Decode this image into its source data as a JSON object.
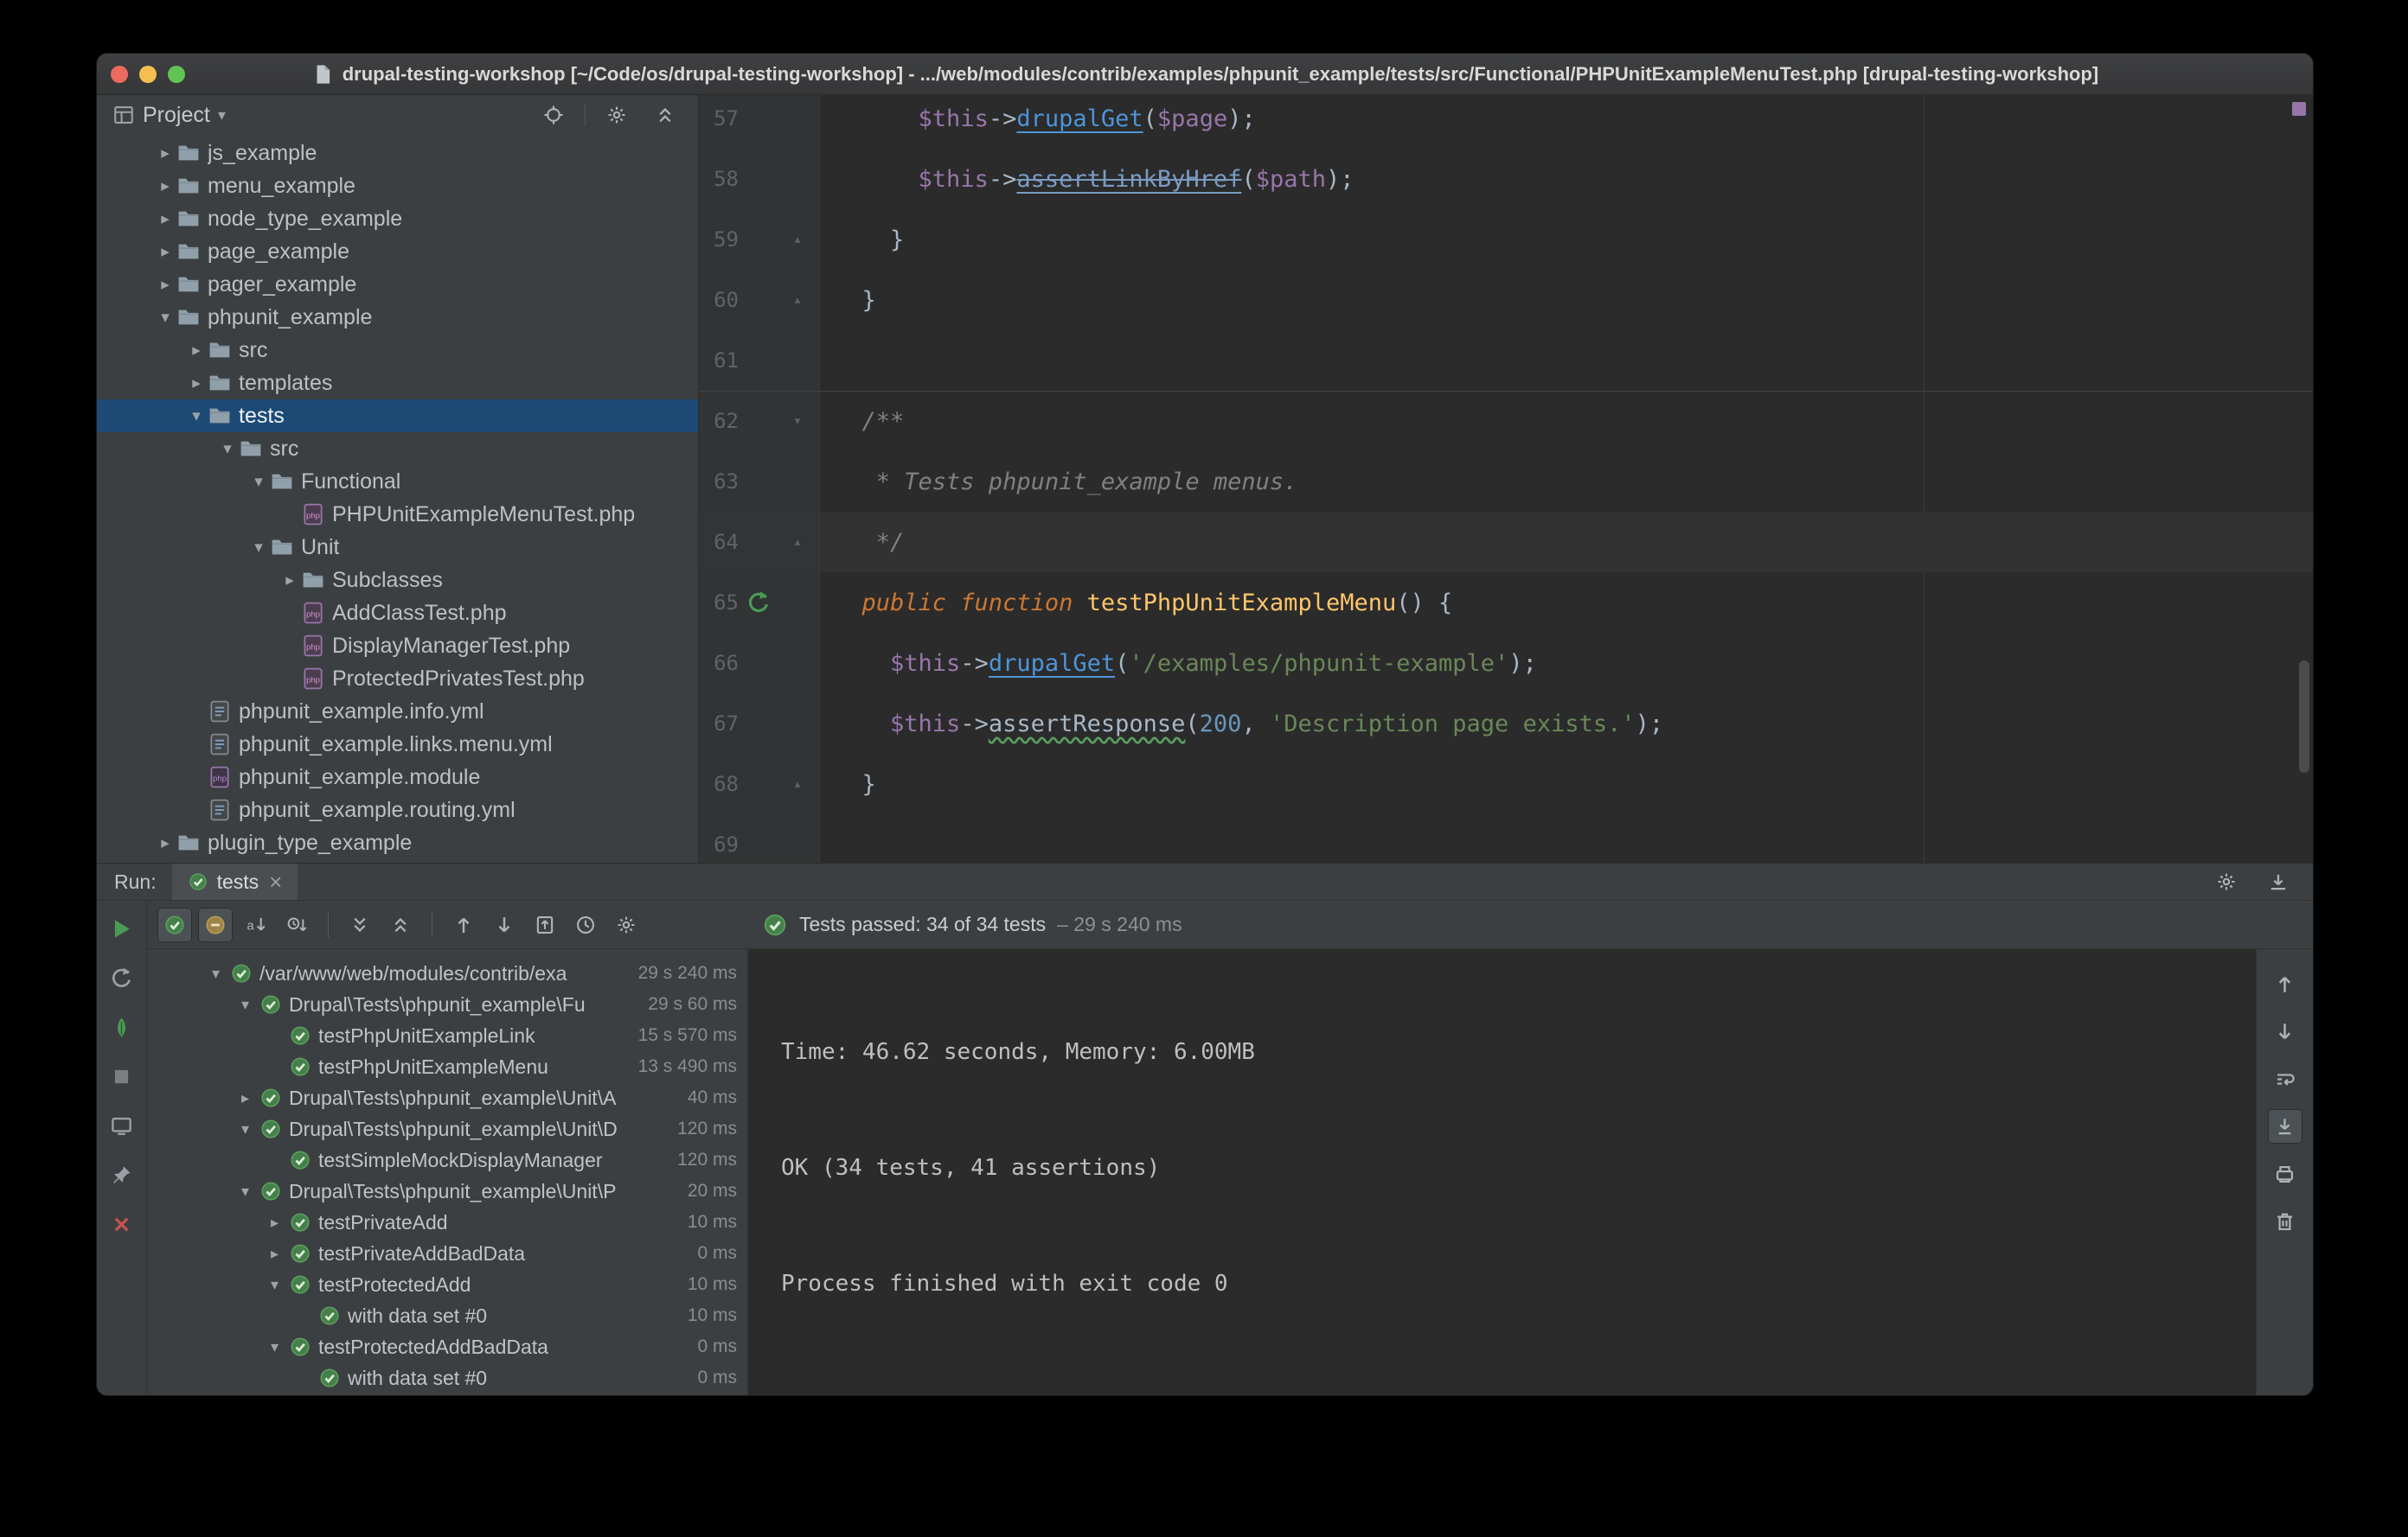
{
  "window": {
    "title": "drupal-testing-workshop [~/Code/os/drupal-testing-workshop] - .../web/modules/contrib/examples/phpunit_example/tests/src/Functional/PHPUnitExampleMenuTest.php [drupal-testing-workshop]"
  },
  "colors": {
    "panel_bg": "#3c3f41",
    "editor_bg": "#2b2b2b",
    "selection_blue": "#1d4a75",
    "pass_green": "#499c54",
    "error_red": "#c75450",
    "link_blue": "#4e94d8",
    "string_green": "#6a8759",
    "keyword_orange": "#cc7832",
    "stripe_purple": "#9876aa"
  },
  "project": {
    "header": {
      "title": "Project"
    },
    "actions": [
      {
        "name": "select-opened-file-button",
        "icon": "target"
      },
      {
        "sep": true
      },
      {
        "name": "settings-button",
        "icon": "gear"
      },
      {
        "name": "collapse-all-button",
        "icon": "collapseAll"
      }
    ],
    "items": [
      {
        "label": "js_example",
        "icon": "folder",
        "arrow": "c",
        "level": 1
      },
      {
        "label": "menu_example",
        "icon": "folder",
        "arrow": "c",
        "level": 1
      },
      {
        "label": "node_type_example",
        "icon": "folder",
        "arrow": "c",
        "level": 1
      },
      {
        "label": "page_example",
        "icon": "folder",
        "arrow": "c",
        "level": 1
      },
      {
        "label": "pager_example",
        "icon": "folder",
        "arrow": "c",
        "level": 1
      },
      {
        "label": "phpunit_example",
        "icon": "folder",
        "arrow": "e",
        "level": 1
      },
      {
        "label": "src",
        "icon": "folder",
        "arrow": "c",
        "level": 2
      },
      {
        "label": "templates",
        "icon": "folder",
        "arrow": "c",
        "level": 2
      },
      {
        "label": "tests",
        "icon": "folder",
        "arrow": "e",
        "level": 2,
        "selected": true
      },
      {
        "label": "src",
        "icon": "folder",
        "arrow": "e",
        "level": 3
      },
      {
        "label": "Functional",
        "icon": "folder",
        "arrow": "e",
        "level": 4
      },
      {
        "label": "PHPUnitExampleMenuTest.php",
        "icon": "php",
        "arrow": "",
        "level": 5
      },
      {
        "label": "Unit",
        "icon": "folder",
        "arrow": "e",
        "level": 4
      },
      {
        "label": "Subclasses",
        "icon": "folder",
        "arrow": "c",
        "level": 5
      },
      {
        "label": "AddClassTest.php",
        "icon": "php",
        "arrow": "",
        "level": 5
      },
      {
        "label": "DisplayManagerTest.php",
        "icon": "php",
        "arrow": "",
        "level": 5
      },
      {
        "label": "ProtectedPrivatesTest.php",
        "icon": "php",
        "arrow": "",
        "level": 5
      },
      {
        "label": "phpunit_example.info.yml",
        "icon": "yml",
        "arrow": "",
        "level": 2
      },
      {
        "label": "phpunit_example.links.menu.yml",
        "icon": "yml",
        "arrow": "",
        "level": 2
      },
      {
        "label": "phpunit_example.module",
        "icon": "mod",
        "arrow": "",
        "level": 2
      },
      {
        "label": "phpunit_example.routing.yml",
        "icon": "yml",
        "arrow": "",
        "level": 2
      },
      {
        "label": "plugin_type_example",
        "icon": "folder",
        "arrow": "c",
        "level": 1
      }
    ]
  },
  "editor": {
    "caret_line": 64,
    "lines": [
      {
        "n": 57,
        "g": "",
        "s": [
          {
            "c": "p",
            "t": "      "
          },
          {
            "c": "vr",
            "t": "$this"
          },
          {
            "c": "p",
            "t": "->"
          },
          {
            "c": "ln",
            "t": "drupalGet"
          },
          {
            "c": "p",
            "t": "("
          },
          {
            "c": "vr",
            "t": "$page"
          },
          {
            "c": "p",
            "t": ");"
          }
        ]
      },
      {
        "n": 58,
        "g": "",
        "s": [
          {
            "c": "p",
            "t": "      "
          },
          {
            "c": "vr",
            "t": "$this"
          },
          {
            "c": "p",
            "t": "->"
          },
          {
            "c": "dp",
            "t": "assertLinkByHref"
          },
          {
            "c": "p",
            "t": "("
          },
          {
            "c": "vr",
            "t": "$path"
          },
          {
            "c": "p",
            "t": ");"
          }
        ]
      },
      {
        "n": 59,
        "g": "foldUp",
        "s": [
          {
            "c": "p",
            "t": "    }"
          }
        ]
      },
      {
        "n": 60,
        "g": "foldUp",
        "s": [
          {
            "c": "p",
            "t": "  }"
          }
        ]
      },
      {
        "n": 61,
        "g": "",
        "s": []
      },
      {
        "n": 62,
        "g": "foldDown",
        "sep": true,
        "s": [
          {
            "c": "cm",
            "t": "  /**"
          }
        ]
      },
      {
        "n": 63,
        "g": "",
        "s": [
          {
            "c": "cm",
            "t": "   * Tests phpunit_example menus."
          }
        ]
      },
      {
        "n": 64,
        "g": "foldUp",
        "s": [
          {
            "c": "cm",
            "t": "   */"
          }
        ]
      },
      {
        "n": 65,
        "g": "run",
        "s": [
          {
            "c": "kw",
            "t": "  public function"
          },
          {
            "c": "p",
            "t": " "
          },
          {
            "c": "fn",
            "t": "testPhpUnitExampleMenu"
          },
          {
            "c": "p",
            "t": "() {"
          }
        ]
      },
      {
        "n": 66,
        "g": "",
        "s": [
          {
            "c": "p",
            "t": "    "
          },
          {
            "c": "vr",
            "t": "$this"
          },
          {
            "c": "p",
            "t": "->"
          },
          {
            "c": "ln",
            "t": "drupalGet"
          },
          {
            "c": "p",
            "t": "("
          },
          {
            "c": "st",
            "t": "'/examples/phpunit-example'"
          },
          {
            "c": "p",
            "t": ");"
          }
        ]
      },
      {
        "n": 67,
        "g": "",
        "s": [
          {
            "c": "p",
            "t": "    "
          },
          {
            "c": "vr",
            "t": "$this"
          },
          {
            "c": "p",
            "t": "->"
          },
          {
            "c": "wn",
            "t": "assertResponse"
          },
          {
            "c": "p",
            "t": "("
          },
          {
            "c": "nm",
            "t": "200"
          },
          {
            "c": "p",
            "t": ", "
          },
          {
            "c": "st",
            "t": "'Description page exists.'"
          },
          {
            "c": "p",
            "t": ");"
          }
        ]
      },
      {
        "n": 68,
        "g": "foldUp",
        "s": [
          {
            "c": "p",
            "t": "  }"
          }
        ]
      },
      {
        "n": 69,
        "g": "",
        "s": []
      }
    ]
  },
  "run": {
    "label": "Run:",
    "tab": {
      "label": "tests",
      "close": "×"
    },
    "tabstrip_actions": [
      {
        "name": "settings-button",
        "icon": "gear"
      },
      {
        "name": "hide-window-button",
        "icon": "hide"
      }
    ],
    "left_toolbar": [
      {
        "name": "rerun-tests-button",
        "icon": "play"
      },
      {
        "name": "rerun-failed-tests-button",
        "icon": "rerunFailed"
      },
      {
        "name": "toggle-auto-test-button",
        "icon": "leaf"
      },
      {
        "name": "stop-button",
        "icon": "stop"
      },
      {
        "name": "show-console-button",
        "icon": "monitor"
      },
      {
        "name": "pin-tab-button",
        "icon": "pin"
      },
      {
        "name": "close-button",
        "icon": "close"
      }
    ],
    "toolbar": [
      {
        "name": "show-passed-button",
        "icon": "pass",
        "pressed": true
      },
      {
        "name": "show-ignored-button",
        "icon": "ignored",
        "pressed": true
      },
      {
        "name": "sort-alphabetically-button",
        "icon": "sortAlpha"
      },
      {
        "name": "sort-by-duration-button",
        "icon": "sortDur"
      },
      {
        "sep": true
      },
      {
        "name": "expand-all-button",
        "icon": "expandAll"
      },
      {
        "name": "collapse-all-button",
        "icon": "collapseAll"
      },
      {
        "sep": true
      },
      {
        "name": "previous-failed-test-button",
        "icon": "up"
      },
      {
        "name": "next-failed-test-button",
        "icon": "down"
      },
      {
        "name": "export-test-results-button",
        "icon": "export"
      },
      {
        "name": "test-history-button",
        "icon": "history"
      },
      {
        "name": "options-button",
        "icon": "gear"
      }
    ],
    "right_toolbar": [
      {
        "name": "scroll-up-button",
        "icon": "up"
      },
      {
        "name": "scroll-down-button",
        "icon": "down"
      },
      {
        "name": "soft-wrap-button",
        "icon": "wrap"
      },
      {
        "name": "scroll-to-end-button",
        "icon": "scrollEnd",
        "pressed": true
      },
      {
        "name": "print-button",
        "icon": "print"
      },
      {
        "name": "clear-console-button",
        "icon": "trash"
      }
    ],
    "status": {
      "text": "Tests passed: 34 of 34 tests",
      "duration": "– 29 s 240 ms"
    },
    "tree": [
      {
        "label": "/var/www/web/modules/contrib/exa",
        "duration": "29 s 240 ms",
        "level": 0,
        "arrow": "e"
      },
      {
        "label": "Drupal\\Tests\\phpunit_example\\Fu",
        "duration": "29 s 60 ms",
        "level": 1,
        "arrow": "e"
      },
      {
        "label": "testPhpUnitExampleLink",
        "duration": "15 s 570 ms",
        "level": 2,
        "arrow": ""
      },
      {
        "label": "testPhpUnitExampleMenu",
        "duration": "13 s 490 ms",
        "level": 2,
        "arrow": ""
      },
      {
        "label": "Drupal\\Tests\\phpunit_example\\Unit\\A",
        "duration": "40 ms",
        "level": 1,
        "arrow": "c"
      },
      {
        "label": "Drupal\\Tests\\phpunit_example\\Unit\\D",
        "duration": "120 ms",
        "level": 1,
        "arrow": "e"
      },
      {
        "label": "testSimpleMockDisplayManager",
        "duration": "120 ms",
        "level": 2,
        "arrow": ""
      },
      {
        "label": "Drupal\\Tests\\phpunit_example\\Unit\\P",
        "duration": "20 ms",
        "level": 1,
        "arrow": "e"
      },
      {
        "label": "testPrivateAdd",
        "duration": "10 ms",
        "level": 2,
        "arrow": "c"
      },
      {
        "label": "testPrivateAddBadData",
        "duration": "0 ms",
        "level": 2,
        "arrow": "c"
      },
      {
        "label": "testProtectedAdd",
        "duration": "10 ms",
        "level": 2,
        "arrow": "e"
      },
      {
        "label": "with data set #0",
        "duration": "10 ms",
        "level": 3,
        "arrow": ""
      },
      {
        "label": "testProtectedAddBadData",
        "duration": "0 ms",
        "level": 2,
        "arrow": "e"
      },
      {
        "label": "with data set #0",
        "duration": "0 ms",
        "level": 3,
        "arrow": ""
      }
    ],
    "console": {
      "lines": [
        "Time: 46.62 seconds, Memory: 6.00MB",
        "OK (34 tests, 41 assertions)",
        "Process finished with exit code 0"
      ]
    }
  }
}
